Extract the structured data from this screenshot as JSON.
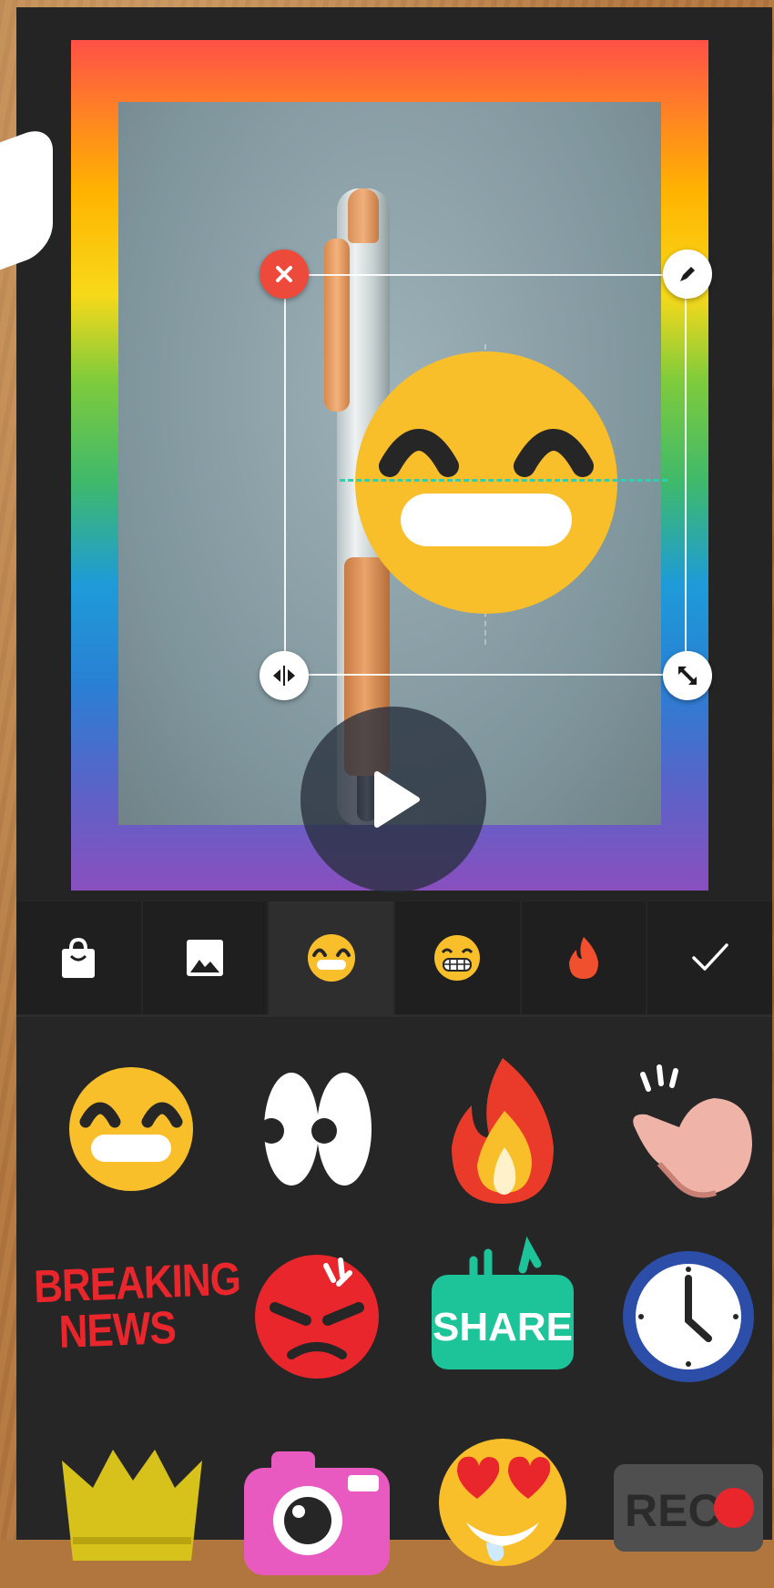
{
  "canvas": {
    "sticker": "grinning-face-sticker",
    "handles": [
      "delete",
      "edit",
      "flip",
      "scale"
    ],
    "play_label": "play"
  },
  "tabs": [
    {
      "id": "shop",
      "icon": "shopping-bag-icon"
    },
    {
      "id": "gallery",
      "icon": "image-gallery-icon"
    },
    {
      "id": "emoji",
      "icon": "grinning-face-icon",
      "active": true
    },
    {
      "id": "emoji2",
      "icon": "grimacing-face-icon"
    },
    {
      "id": "fire",
      "icon": "fire-icon"
    },
    {
      "id": "done",
      "icon": "checkmark-icon"
    }
  ],
  "stickers": {
    "breaking_news_line1": "BREAKING",
    "breaking_news_line2": "NEWS",
    "share_label": "SHARE",
    "rec_label": "REC"
  },
  "colors": {
    "panel": "#242424",
    "accent_delete": "#ee4a3c",
    "guide": "#2fd0b0",
    "emoji_yellow": "#f8bf2a"
  }
}
